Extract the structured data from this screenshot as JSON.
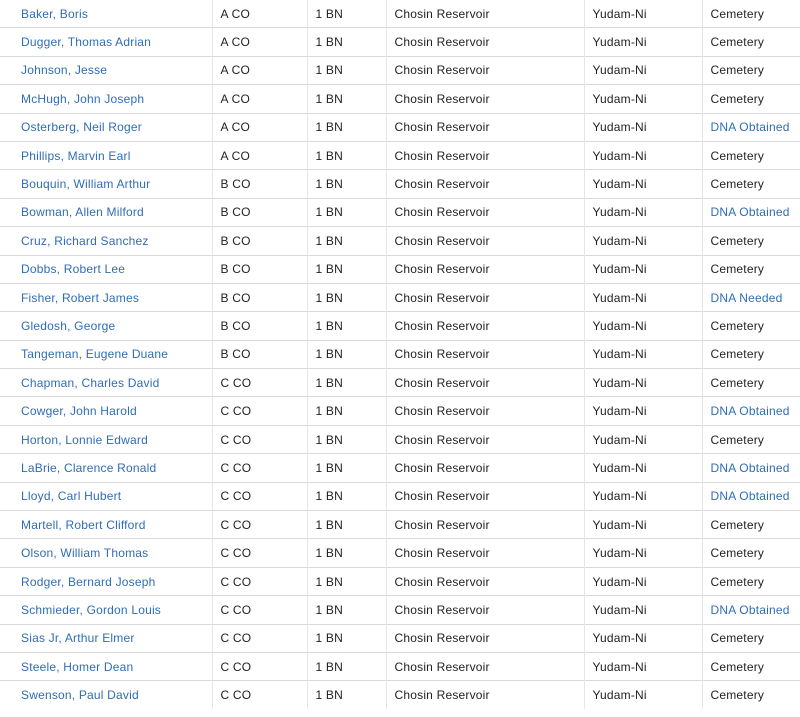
{
  "rows": [
    {
      "name": "Baker, Boris",
      "company": "A CO",
      "battalion": "1 BN",
      "location": "Chosin Reservoir",
      "area": "Yudam-Ni",
      "status": "Cemetery",
      "status_link": false
    },
    {
      "name": "Dugger, Thomas Adrian",
      "company": "A CO",
      "battalion": "1 BN",
      "location": "Chosin Reservoir",
      "area": "Yudam-Ni",
      "status": "Cemetery",
      "status_link": false
    },
    {
      "name": "Johnson, Jesse",
      "company": "A CO",
      "battalion": "1 BN",
      "location": "Chosin Reservoir",
      "area": "Yudam-Ni",
      "status": "Cemetery",
      "status_link": false
    },
    {
      "name": "McHugh, John Joseph",
      "company": "A CO",
      "battalion": "1 BN",
      "location": "Chosin Reservoir",
      "area": "Yudam-Ni",
      "status": "Cemetery",
      "status_link": false
    },
    {
      "name": "Osterberg, Neil Roger",
      "company": "A CO",
      "battalion": "1 BN",
      "location": "Chosin Reservoir",
      "area": "Yudam-Ni",
      "status": "DNA Obtained",
      "status_link": true
    },
    {
      "name": "Phillips, Marvin Earl",
      "company": "A CO",
      "battalion": "1 BN",
      "location": "Chosin Reservoir",
      "area": "Yudam-Ni",
      "status": "Cemetery",
      "status_link": false
    },
    {
      "name": "Bouquin, William Arthur",
      "company": "B CO",
      "battalion": "1 BN",
      "location": "Chosin Reservoir",
      "area": "Yudam-Ni",
      "status": "Cemetery",
      "status_link": false
    },
    {
      "name": "Bowman, Allen Milford",
      "company": "B CO",
      "battalion": "1 BN",
      "location": "Chosin Reservoir",
      "area": "Yudam-Ni",
      "status": "DNA Obtained",
      "status_link": true
    },
    {
      "name": "Cruz, Richard Sanchez",
      "company": "B CO",
      "battalion": "1 BN",
      "location": "Chosin Reservoir",
      "area": "Yudam-Ni",
      "status": "Cemetery",
      "status_link": false
    },
    {
      "name": "Dobbs, Robert Lee",
      "company": "B CO",
      "battalion": "1 BN",
      "location": "Chosin Reservoir",
      "area": "Yudam-Ni",
      "status": "Cemetery",
      "status_link": false
    },
    {
      "name": "Fisher, Robert James",
      "company": "B CO",
      "battalion": "1 BN",
      "location": "Chosin Reservoir",
      "area": "Yudam-Ni",
      "status": "DNA Needed",
      "status_link": true
    },
    {
      "name": "Gledosh, George",
      "company": "B CO",
      "battalion": "1 BN",
      "location": "Chosin Reservoir",
      "area": "Yudam-Ni",
      "status": "Cemetery",
      "status_link": false
    },
    {
      "name": "Tangeman, Eugene Duane",
      "company": "B CO",
      "battalion": "1 BN",
      "location": "Chosin Reservoir",
      "area": "Yudam-Ni",
      "status": "Cemetery",
      "status_link": false
    },
    {
      "name": "Chapman, Charles David",
      "company": "C CO",
      "battalion": "1 BN",
      "location": "Chosin Reservoir",
      "area": "Yudam-Ni",
      "status": "Cemetery",
      "status_link": false
    },
    {
      "name": "Cowger, John Harold",
      "company": "C CO",
      "battalion": "1 BN",
      "location": "Chosin Reservoir",
      "area": "Yudam-Ni",
      "status": "DNA Obtained",
      "status_link": true
    },
    {
      "name": "Horton, Lonnie Edward",
      "company": "C CO",
      "battalion": "1 BN",
      "location": "Chosin Reservoir",
      "area": "Yudam-Ni",
      "status": "Cemetery",
      "status_link": false
    },
    {
      "name": "LaBrie, Clarence Ronald",
      "company": "C CO",
      "battalion": "1 BN",
      "location": "Chosin Reservoir",
      "area": "Yudam-Ni",
      "status": "DNA Obtained",
      "status_link": true
    },
    {
      "name": "Lloyd, Carl Hubert",
      "company": "C CO",
      "battalion": "1 BN",
      "location": "Chosin Reservoir",
      "area": "Yudam-Ni",
      "status": "DNA Obtained",
      "status_link": true
    },
    {
      "name": "Martell, Robert Clifford",
      "company": "C CO",
      "battalion": "1 BN",
      "location": "Chosin Reservoir",
      "area": "Yudam-Ni",
      "status": "Cemetery",
      "status_link": false
    },
    {
      "name": "Olson, William Thomas",
      "company": "C CO",
      "battalion": "1 BN",
      "location": "Chosin Reservoir",
      "area": "Yudam-Ni",
      "status": "Cemetery",
      "status_link": false
    },
    {
      "name": "Rodger, Bernard Joseph",
      "company": "C CO",
      "battalion": "1 BN",
      "location": "Chosin Reservoir",
      "area": "Yudam-Ni",
      "status": "Cemetery",
      "status_link": false
    },
    {
      "name": "Schmieder, Gordon Louis",
      "company": "C CO",
      "battalion": "1 BN",
      "location": "Chosin Reservoir",
      "area": "Yudam-Ni",
      "status": "DNA Obtained",
      "status_link": true
    },
    {
      "name": "Sias Jr, Arthur Elmer",
      "company": "C CO",
      "battalion": "1 BN",
      "location": "Chosin Reservoir",
      "area": "Yudam-Ni",
      "status": "Cemetery",
      "status_link": false
    },
    {
      "name": "Steele, Homer Dean",
      "company": "C CO",
      "battalion": "1 BN",
      "location": "Chosin Reservoir",
      "area": "Yudam-Ni",
      "status": "Cemetery",
      "status_link": false
    },
    {
      "name": "Swenson, Paul David",
      "company": "C CO",
      "battalion": "1 BN",
      "location": "Chosin Reservoir",
      "area": "Yudam-Ni",
      "status": "Cemetery",
      "status_link": false
    }
  ],
  "colors": {
    "link": "#2f6db5",
    "text": "#222222",
    "row_border": "#d9d9d9"
  }
}
